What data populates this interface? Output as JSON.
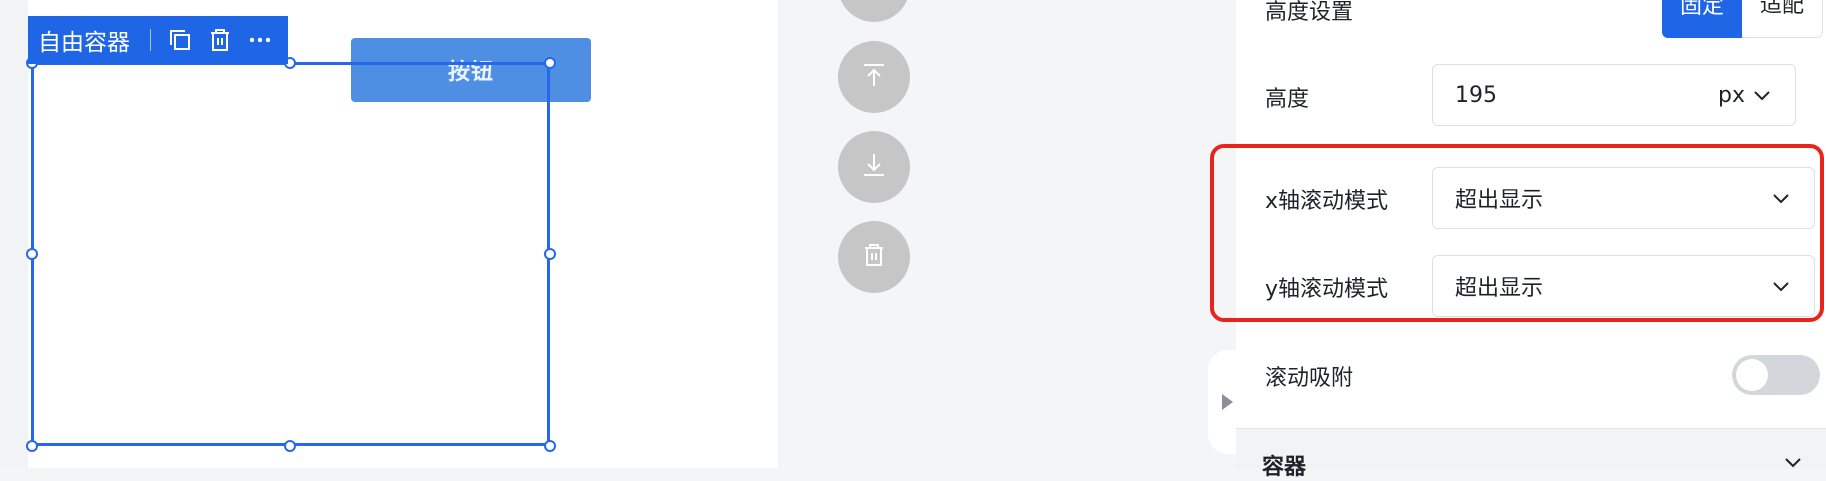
{
  "colors": {
    "accent": "#1e66e6",
    "highlight": "#e8241b",
    "fab": "#c6c6c6",
    "button_preview": "#4f8fe3"
  },
  "toolbar": {
    "label": "自由容器",
    "icons": [
      "copy-icon",
      "delete-icon",
      "more-icon"
    ]
  },
  "canvas": {
    "button_label": "按钮"
  },
  "fabs": [
    "move-up-icon",
    "move-down-icon",
    "delete-icon"
  ],
  "panel": {
    "height_setting": {
      "label": "高度设置",
      "options": [
        "固定",
        "适配"
      ],
      "active": "固定"
    },
    "height": {
      "label": "高度",
      "value": "195",
      "unit": "px"
    },
    "x_scroll": {
      "label": "x轴滚动模式",
      "value": "超出显示"
    },
    "y_scroll": {
      "label": "y轴滚动模式",
      "value": "超出显示"
    },
    "scroll_snap": {
      "label": "滚动吸附",
      "enabled": false
    },
    "section": {
      "title": "容器"
    }
  }
}
